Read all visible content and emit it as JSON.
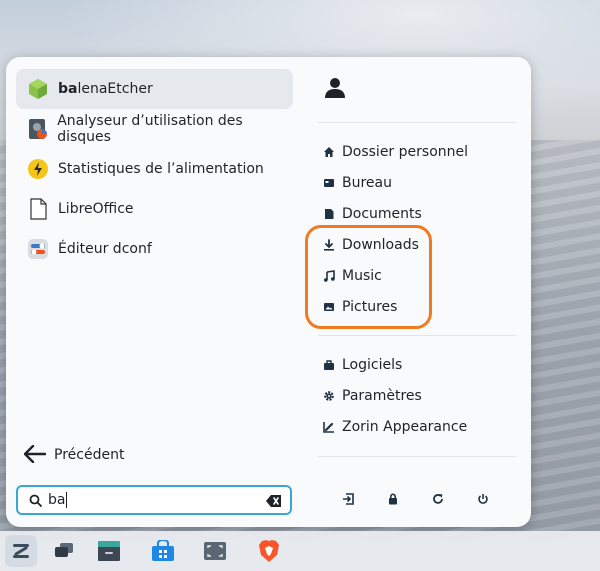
{
  "apps": [
    {
      "label_bold": "ba",
      "label_rest": "lenaEtcher",
      "icon": "balenaetcher-icon",
      "selected": true
    },
    {
      "label": "Analyseur d’utilisation des disques",
      "icon": "disk-usage-icon"
    },
    {
      "label": "Statistiques de l’alimentation",
      "icon": "power-statistics-icon"
    },
    {
      "label": "LibreOffice",
      "icon": "libreoffice-icon"
    },
    {
      "label": "Éditeur dconf",
      "icon": "dconf-editor-icon"
    }
  ],
  "back_label": "Précédent",
  "search": {
    "value": "ba"
  },
  "places": [
    {
      "label": "Dossier personnel",
      "icon": "home-icon"
    },
    {
      "label": "Bureau",
      "icon": "desktop-icon"
    },
    {
      "label": "Documents",
      "icon": "document-icon"
    },
    {
      "label": "Downloads",
      "icon": "download-icon"
    },
    {
      "label": "Music",
      "icon": "music-icon"
    },
    {
      "label": "Pictures",
      "icon": "pictures-icon"
    }
  ],
  "system": [
    {
      "label": "Logiciels",
      "icon": "software-icon"
    },
    {
      "label": "Paramètres",
      "icon": "settings-gear-icon"
    },
    {
      "label": "Zorin Appearance",
      "icon": "appearance-icon"
    }
  ],
  "session_buttons": [
    "logout-icon",
    "lock-icon",
    "restart-icon",
    "power-icon"
  ],
  "taskbar": [
    "zorin-menu-icon",
    "workspaces-icon",
    "files-icon",
    "software-store-icon",
    "screenshot-icon",
    "brave-browser-icon"
  ],
  "colors": {
    "accent": "#39a6d8",
    "highlight": "#ef7a20",
    "panel": "#f9fafb",
    "icon": "#1f3244"
  }
}
